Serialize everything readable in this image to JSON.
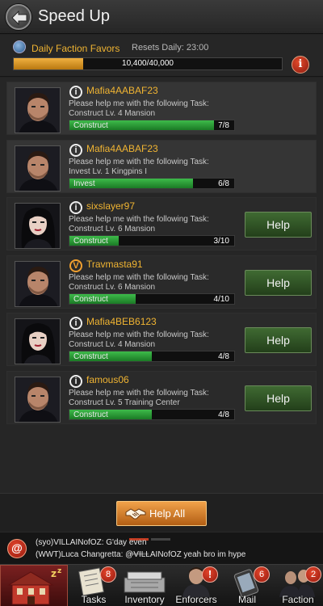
{
  "header": {
    "title": "Speed Up"
  },
  "favors": {
    "title": "Daily Faction Favors",
    "reset": "Resets Daily: 23:00",
    "progress_text": "10,400/40,000",
    "progress_fraction": 0.26
  },
  "tasks": [
    {
      "status": "i",
      "name": "Mafia4AABAF23",
      "line1": "Please help me with the following Task:",
      "line2": "Construct Lv. 4 Mansion",
      "bar_label": "Construct",
      "count": "7/8",
      "progress": 0.875,
      "help": "",
      "avatar": "male"
    },
    {
      "status": "i",
      "name": "Mafia4AABAF23",
      "line1": "Please help me with the following Task:",
      "line2": "Invest Lv. 1 Kingpins I",
      "bar_label": "Invest",
      "count": "6/8",
      "progress": 0.75,
      "help": "",
      "avatar": "male"
    },
    {
      "status": "i",
      "name": "sixslayer97",
      "line1": "Please help me with the following Task:",
      "line2": "Construct Lv. 6 Mansion",
      "bar_label": "Construct",
      "count": "3/10",
      "progress": 0.3,
      "help": "Help",
      "avatar": "female"
    },
    {
      "status": "v",
      "name": "Travmasta91",
      "line1": "Please help me with the following Task:",
      "line2": "Construct Lv. 6 Mansion",
      "bar_label": "Construct",
      "count": "4/10",
      "progress": 0.4,
      "help": "Help",
      "avatar": "male"
    },
    {
      "status": "i",
      "name": "Mafia4BEB6123",
      "line1": "Please help me with the following Task:",
      "line2": "Construct Lv. 4 Mansion",
      "bar_label": "Construct",
      "count": "4/8",
      "progress": 0.5,
      "help": "Help",
      "avatar": "female"
    },
    {
      "status": "i",
      "name": "famous06",
      "line1": "Please help me with the following Task:",
      "line2": "Construct Lv. 5 Training Center",
      "bar_label": "Construct",
      "count": "4/8",
      "progress": 0.5,
      "help": "Help",
      "avatar": "male"
    }
  ],
  "help_all": {
    "label": "Help All"
  },
  "chat": {
    "icon": "@",
    "lines": [
      "(syo)VILLAINofOZ: G'day even",
      "(WWT)Luca Changretta: @VILLAINofOZ yeah bro im hype"
    ]
  },
  "nav": {
    "items": [
      {
        "label": "Tasks",
        "badge": "8"
      },
      {
        "label": "Inventory",
        "badge": ""
      },
      {
        "label": "Enforcers",
        "badge": "!"
      },
      {
        "label": "Mail",
        "badge": "6"
      },
      {
        "label": "Faction",
        "badge": "2"
      }
    ]
  }
}
